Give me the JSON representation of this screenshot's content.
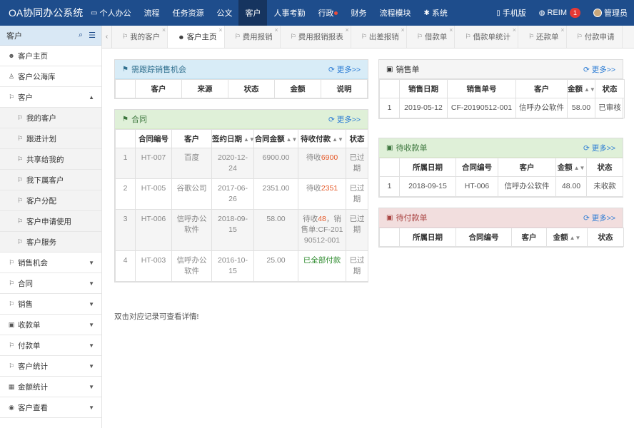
{
  "app": {
    "title": "OA协同办公系统"
  },
  "nav": {
    "items": [
      {
        "label": "个人办公",
        "icon": "monitor-icon"
      },
      {
        "label": "流程"
      },
      {
        "label": "任务资源"
      },
      {
        "label": "公文"
      },
      {
        "label": "客户",
        "active": true
      },
      {
        "label": "人事考勤"
      },
      {
        "label": "行政"
      },
      {
        "label": "财务"
      },
      {
        "label": "流程模块"
      },
      {
        "label": "系统",
        "icon": "gear-icon"
      }
    ],
    "mobile": "手机版",
    "reim": "REIM",
    "reim_badge": "1",
    "user": "管理员"
  },
  "sidebar": {
    "title": "客户",
    "items": [
      {
        "label": "客户主页"
      },
      {
        "label": "客户公海库"
      },
      {
        "label": "客户"
      },
      {
        "label": "我的客户"
      },
      {
        "label": "跟进计划"
      },
      {
        "label": "共享给我的"
      },
      {
        "label": "我下属客户"
      },
      {
        "label": "客户分配"
      },
      {
        "label": "客户申请使用"
      },
      {
        "label": "客户服务"
      },
      {
        "label": "销售机会"
      },
      {
        "label": "合同"
      },
      {
        "label": "销售"
      },
      {
        "label": "收款单"
      },
      {
        "label": "付款单"
      },
      {
        "label": "客户统计"
      },
      {
        "label": "金额统计"
      },
      {
        "label": "客户查看"
      }
    ]
  },
  "tabs": [
    "我的客户",
    "客户主页",
    "费用报销",
    "费用报销报表",
    "出差报销",
    "借款单",
    "借款单统计",
    "还款单",
    "付款申请"
  ],
  "panels": {
    "more": "更多>>",
    "opportunity": {
      "title": "需跟踪销售机会",
      "columns": [
        "客户",
        "来源",
        "状态",
        "金额",
        "说明"
      ]
    },
    "contract": {
      "title": "合同",
      "columns": [
        "合同编号",
        "客户",
        "签约日期",
        "合同金额",
        "待收付款",
        "状态"
      ],
      "rows": [
        {
          "no": "1",
          "code": "HT-007",
          "customer": "百度",
          "date": "2020-12-24",
          "amount": "6900.00",
          "pending_prefix": "待收",
          "pending_value": "6900",
          "pending_suffix": "",
          "status": "已过期"
        },
        {
          "no": "2",
          "code": "HT-005",
          "customer": "谷歌公司",
          "date": "2017-06-26",
          "amount": "2351.00",
          "pending_prefix": "待收",
          "pending_value": "2351",
          "pending_suffix": "",
          "status": "已过期"
        },
        {
          "no": "3",
          "code": "HT-006",
          "customer": "信呼办公软件",
          "date": "2018-09-15",
          "amount": "58.00",
          "pending_prefix": "待收",
          "pending_value": "48",
          "pending_suffix": "，销售单:CF-20190512-001",
          "status": "已过期"
        },
        {
          "no": "4",
          "code": "HT-003",
          "customer": "信呼办公软件",
          "date": "2016-10-15",
          "amount": "25.00",
          "pending_prefix": "",
          "pending_value": "",
          "pending_suffix": "已全部付款",
          "status": "已过期"
        }
      ]
    },
    "sales": {
      "title": "销售单",
      "columns": [
        "销售日期",
        "销售单号",
        "客户",
        "金额",
        "状态"
      ],
      "rows": [
        {
          "no": "1",
          "date": "2019-05-12",
          "code": "CF-20190512-001",
          "customer": "信呼办公软件",
          "amount": "58.00",
          "status": "已审核"
        }
      ]
    },
    "receivable": {
      "title": "待收款单",
      "columns": [
        "所属日期",
        "合同编号",
        "客户",
        "金额",
        "状态"
      ],
      "rows": [
        {
          "no": "1",
          "date": "2018-09-15",
          "code": "HT-006",
          "customer": "信呼办公软件",
          "amount": "48.00",
          "status": "未收款"
        }
      ]
    },
    "payable": {
      "title": "待付款单",
      "columns": [
        "所属日期",
        "合同编号",
        "客户",
        "金额",
        "状态"
      ]
    }
  },
  "footnote": "双击对应记录可查看详情!",
  "colors": {
    "topbar": "#1e4d8c",
    "accent_link": "#2a7bd4",
    "pending_red": "#e55a2a",
    "paid_green": "#2e8b2e"
  }
}
